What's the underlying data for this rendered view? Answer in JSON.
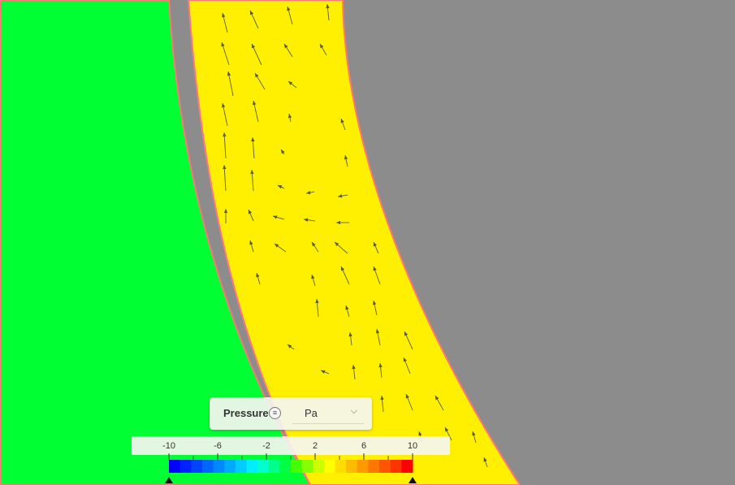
{
  "legend": {
    "title": "Pressure",
    "menu_icon": "menu-icon",
    "unit": "Pa",
    "unit_chevron": "chevron-down-icon",
    "ticks": [
      "-10",
      "-6",
      "-2",
      "2",
      "6",
      "10"
    ],
    "tick_values": [
      -10,
      -6,
      -2,
      2,
      6,
      10
    ],
    "range": [
      -10,
      10
    ],
    "colors": [
      "#0000ff",
      "#0022ff",
      "#0044ff",
      "#0066ff",
      "#0088ff",
      "#00aaff",
      "#00ccff",
      "#00eeff",
      "#00ffcc",
      "#00ff88",
      "#00ff44",
      "#44ff00",
      "#88ff00",
      "#ccff00",
      "#ffff00",
      "#ffdd00",
      "#ffbb00",
      "#ff9900",
      "#ff7700",
      "#ff5500",
      "#ff3300",
      "#ff0000"
    ]
  },
  "viz": {
    "left_region_color": "#00ff33",
    "channel_color": "#ffef00",
    "background_color": "#8c8c8c",
    "edge_color": "#ff7777"
  }
}
